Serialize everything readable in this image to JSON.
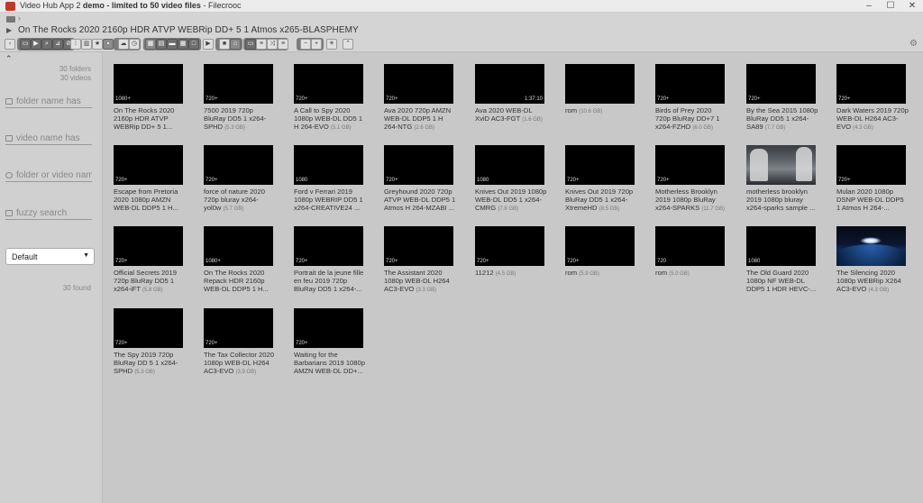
{
  "window": {
    "app_name": "Video Hub App 2",
    "demo_label": "demo - limited to 50 video files",
    "file_name": "- Filecrooc",
    "minimize": "–",
    "maximize": "☐",
    "close": "✕"
  },
  "path": {
    "chevron": "›",
    "current": "On The Rocks 2020 2160p HDR ATVP WEBRip DD+ 5 1 Atmos x265-BLASPHEMY"
  },
  "sidebar": {
    "folder_count": "30 folders",
    "video_count": "30 videos",
    "filters": [
      {
        "placeholder": "folder name has"
      },
      {
        "placeholder": "video name has"
      },
      {
        "placeholder": "folder or video name"
      },
      {
        "placeholder": "fuzzy search"
      }
    ],
    "sort_value": "Default",
    "found": "30 found"
  },
  "videos": [
    {
      "title": "On The Rocks 2020 2160p HDR ATVP WEBRip DD+ 5 1...",
      "size": "",
      "res": "1080+",
      "dur": ""
    },
    {
      "title": "7500 2019 720p BluRay DD5 1 x264-SPHD",
      "size": "(5.3 GB)",
      "res": "720+",
      "dur": ""
    },
    {
      "title": "A Call to Spy 2020 1080p WEB-DL DD5 1 H 264-EVO",
      "size": "(5.1 GB)",
      "res": "720+",
      "dur": ""
    },
    {
      "title": "Ava 2020 720p AMZN WEB-DL DDP5 1 H 264-NTG",
      "size": "(2.6 GB)",
      "res": "720+",
      "dur": ""
    },
    {
      "title": "Ava 2020 WEB-DL XviD AC3-FGT",
      "size": "(1.6 GB)",
      "res": "",
      "dur": "1:37:10"
    },
    {
      "title": "rom",
      "size": "(10.6 GB)",
      "res": "",
      "dur": ""
    },
    {
      "title": "Birds of Prey 2020 720p BluRay DD+7 1 x264-FZHD",
      "size": "(6.0 GB)",
      "res": "720+",
      "dur": ""
    },
    {
      "title": "By the Sea 2015 1080p BluRay DD5 1 x264-SA89",
      "size": "(7.7 GB)",
      "res": "720+",
      "dur": ""
    },
    {
      "title": "Dark Waters 2019 720p WEB-DL H264 AC3-EVO",
      "size": "(4.3 GB)",
      "res": "720+",
      "dur": ""
    },
    {
      "title": "Escape from Pretoria 2020 1080p AMZN WEB-DL DDP5 1 H...",
      "size": "",
      "res": "720+",
      "dur": ""
    },
    {
      "title": "force of nature 2020 720p bluray x264-yol0w",
      "size": "(5.7 GB)",
      "res": "720+",
      "dur": ""
    },
    {
      "title": "Ford v Ferrari 2019 1080p WEBRIP DD5 1 x264-CREATIVE24 ...",
      "size": "",
      "res": "1080",
      "dur": ""
    },
    {
      "title": "Greyhound 2020 720p ATVP WEB-DL DDP5 1 Atmos H 264-MZABI ...",
      "size": "",
      "res": "720+",
      "dur": ""
    },
    {
      "title": "Knives Out 2019 1080p WEB-DL DD5 1 x264-CMRG",
      "size": "(7.8 GB)",
      "res": "1080",
      "dur": ""
    },
    {
      "title": "Knives Out 2019 720p BluRay DD5 1 x264-XtremeHD",
      "size": "(8.5 GB)",
      "res": "720+",
      "dur": ""
    },
    {
      "title": "Motherless Brooklyn 2019 1080p BluRay x264-SPARKS",
      "size": "(11.7 GB)",
      "res": "720+",
      "dur": ""
    },
    {
      "title": "motherless brooklyn 2019 1080p bluray x264-sparks sample ...",
      "size": "",
      "res": "",
      "dur": ""
    },
    {
      "title": "Mulan 2020 1080p DSNP WEB-DL DDP5 1 Atmos H 264-...",
      "size": "",
      "res": "720+",
      "dur": ""
    },
    {
      "title": "Official Secrets 2019 720p BluRay DD5 1 x264-iFT",
      "size": "(5.8 GB)",
      "res": "720+",
      "dur": ""
    },
    {
      "title": "On The Rocks 2020 Repack HDR 2160p WEB-DL DDP5 1 H...",
      "size": "",
      "res": "1080+",
      "dur": ""
    },
    {
      "title": "Portrait de la jeune fille en feu 2019 720p BluRay DD5 1 x264-...",
      "size": "",
      "res": "720+",
      "dur": ""
    },
    {
      "title": "The Assistant 2020 1080p WEB-DL H264 AC3-EVO",
      "size": "(3.3 GB)",
      "res": "720+",
      "dur": ""
    },
    {
      "title": "11212",
      "size": "(4.5 GB)",
      "res": "720+",
      "dur": ""
    },
    {
      "title": "rom",
      "size": "(5.9 GB)",
      "res": "720+",
      "dur": ""
    },
    {
      "title": "rom",
      "size": "(5.0 GB)",
      "res": "720",
      "dur": ""
    },
    {
      "title": "The Old Guard 2020 1080p NF WEB-DL DDP5 1 HDR HEVC-...",
      "size": "",
      "res": "1080",
      "dur": ""
    },
    {
      "title": "The Silencing 2020 1080p WEBRip X264 AC3-EVO",
      "size": "(4.3 GB)",
      "res": "720+",
      "dur": ""
    },
    {
      "title": "The Spy 2019 720p BluRay DD 5 1 x264-SPHD",
      "size": "(5.3 GB)",
      "res": "720+",
      "dur": ""
    },
    {
      "title": "The Tax Collector 2020 1080p WEB-DL H264 AC3-EVO",
      "size": "(3.9 GB)",
      "res": "720+",
      "dur": ""
    },
    {
      "title": "Waiting for the Barbarians 2019 1080p AMZN WEB-DL DD+...",
      "size": "",
      "res": "720+",
      "dur": ""
    }
  ],
  "toolbar": {
    "icons": [
      "back-icon",
      "folder-toggle-icon",
      "play-icon",
      "search-icon",
      "filter-icon",
      "tag-icon",
      "details-icon",
      "bar-chart-icon",
      "star-icon",
      "thumbnail-icon",
      "cloud-icon",
      "clock-icon",
      "grid-view-icon",
      "list-view-icon",
      "filmstrip-icon",
      "details-view-icon",
      "full-view-icon",
      "play-mode-icon",
      "stop-icon",
      "tag-mode-icon",
      "playlist-icon",
      "menu-icon",
      "shuffle-icon",
      "sort-icon",
      "zoom-out-icon",
      "zoom-in-icon",
      "brightness-icon",
      "up-icon",
      "settings-gear-icon"
    ]
  }
}
